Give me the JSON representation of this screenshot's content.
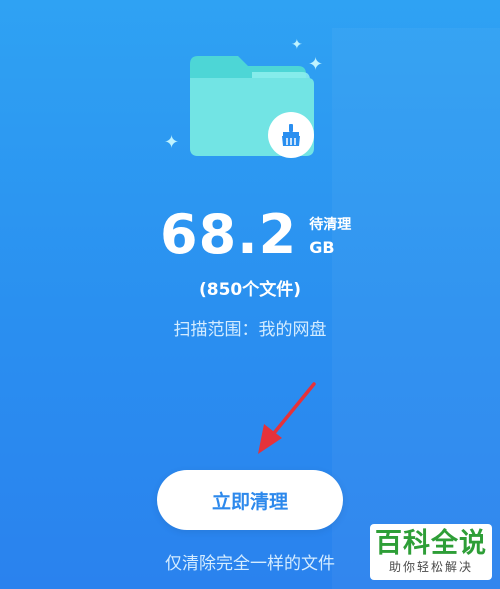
{
  "scan": {
    "size_value": "68.2",
    "pending_label": "待清理",
    "size_unit": "GB",
    "file_count": "(850个文件)",
    "scope": "扫描范围：我的网盘"
  },
  "actions": {
    "clean_now": "立即清理",
    "note": "仅清除完全一样的文件"
  },
  "icons": {
    "folder": "folder-icon",
    "broom": "broom-icon",
    "sparkles": "sparkle-icon",
    "arrow": "annotation-arrow"
  },
  "colors": {
    "background": "#2a8ff0",
    "folder": "#6fe6e6",
    "button_text": "#2d89ec",
    "arrow": "#e5323a",
    "watermark_green": "#2e9e37"
  },
  "watermark": {
    "title": "百科全说",
    "subtitle": "助你轻松解决"
  }
}
